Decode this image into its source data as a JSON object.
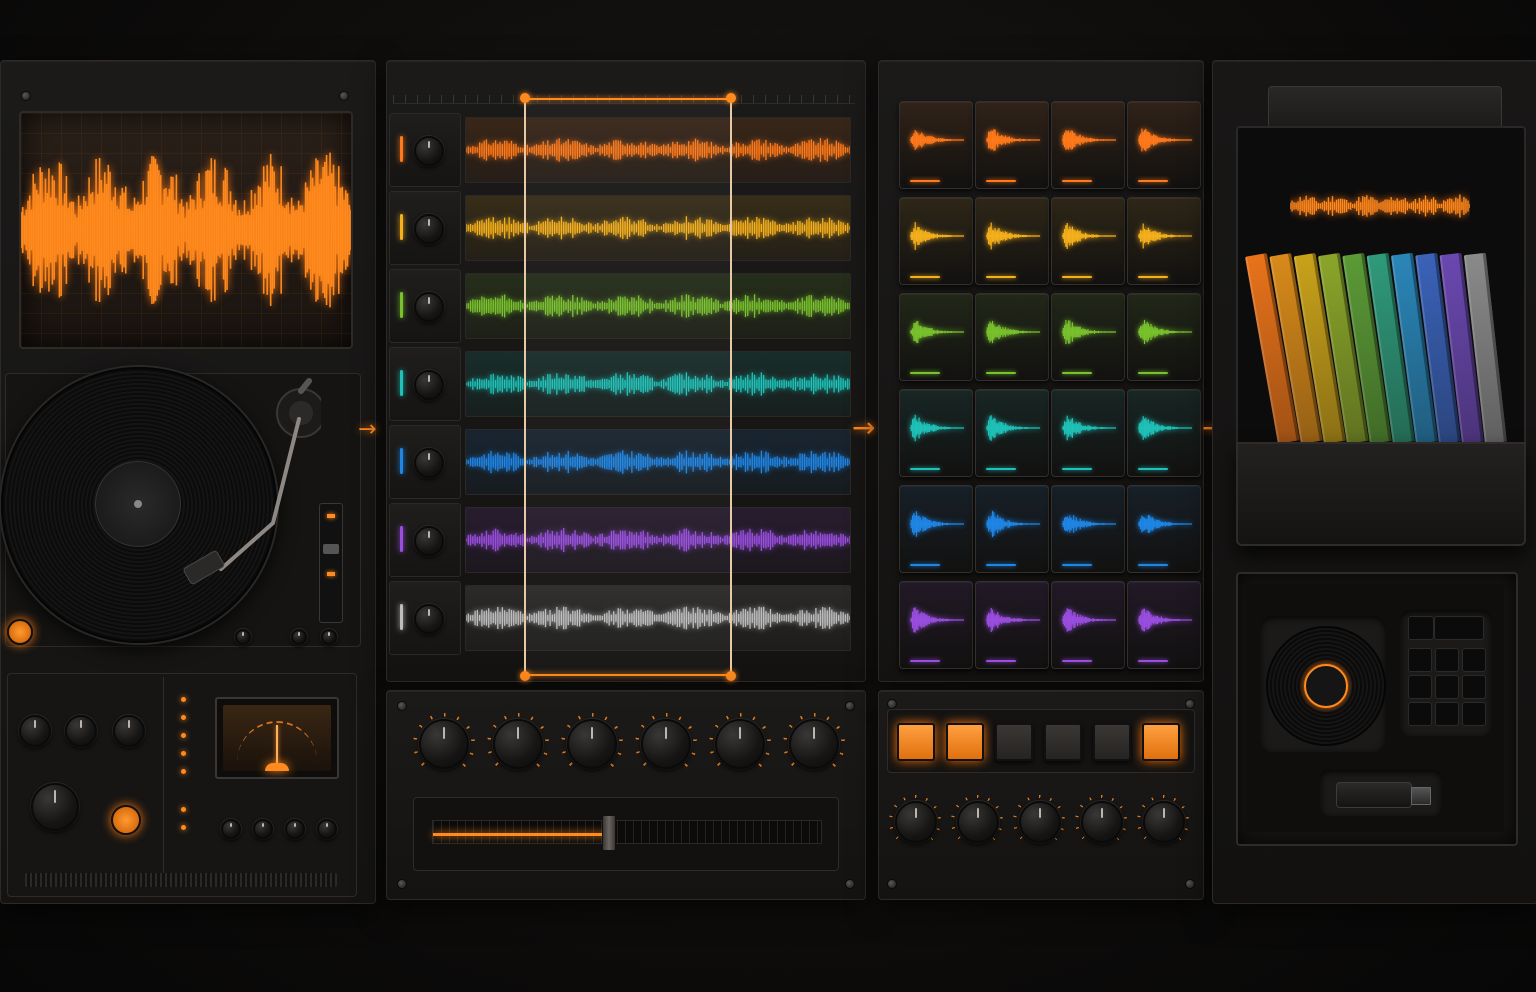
{
  "colors": {
    "accent": "#ff8a1e",
    "background": "#0c0b0a",
    "panel": "#181716",
    "tracks": [
      "#ff7a1a",
      "#f5b01c",
      "#79c22e",
      "#1fc2b8",
      "#1f86e6",
      "#9a4ee0",
      "#bdbdbd"
    ]
  },
  "turntable_unit": {
    "display_icon": "waveform-icon",
    "deck_icon": "vinyl-record-icon",
    "meter_icon": "vu-meter-icon"
  },
  "multitrack_editor": {
    "track_count": 7,
    "selection_icon": "selection-range-icon",
    "fader_position": 0.45
  },
  "sample_pad_grid": {
    "rows": 6,
    "columns": 4,
    "pad_icon": "sample-waveform-icon",
    "step_buttons_lit": [
      true,
      true,
      false,
      false,
      false,
      true
    ]
  },
  "export_package": {
    "box_icon": "sample-pack-box-icon",
    "usb_icon": "usb-drive-icon",
    "vinyl_icon": "vinyl-record-icon",
    "pad_controller_icon": "pad-controller-icon"
  },
  "flow_arrows": [
    "arrow-right-icon",
    "arrow-right-icon",
    "arrow-right-icon"
  ]
}
